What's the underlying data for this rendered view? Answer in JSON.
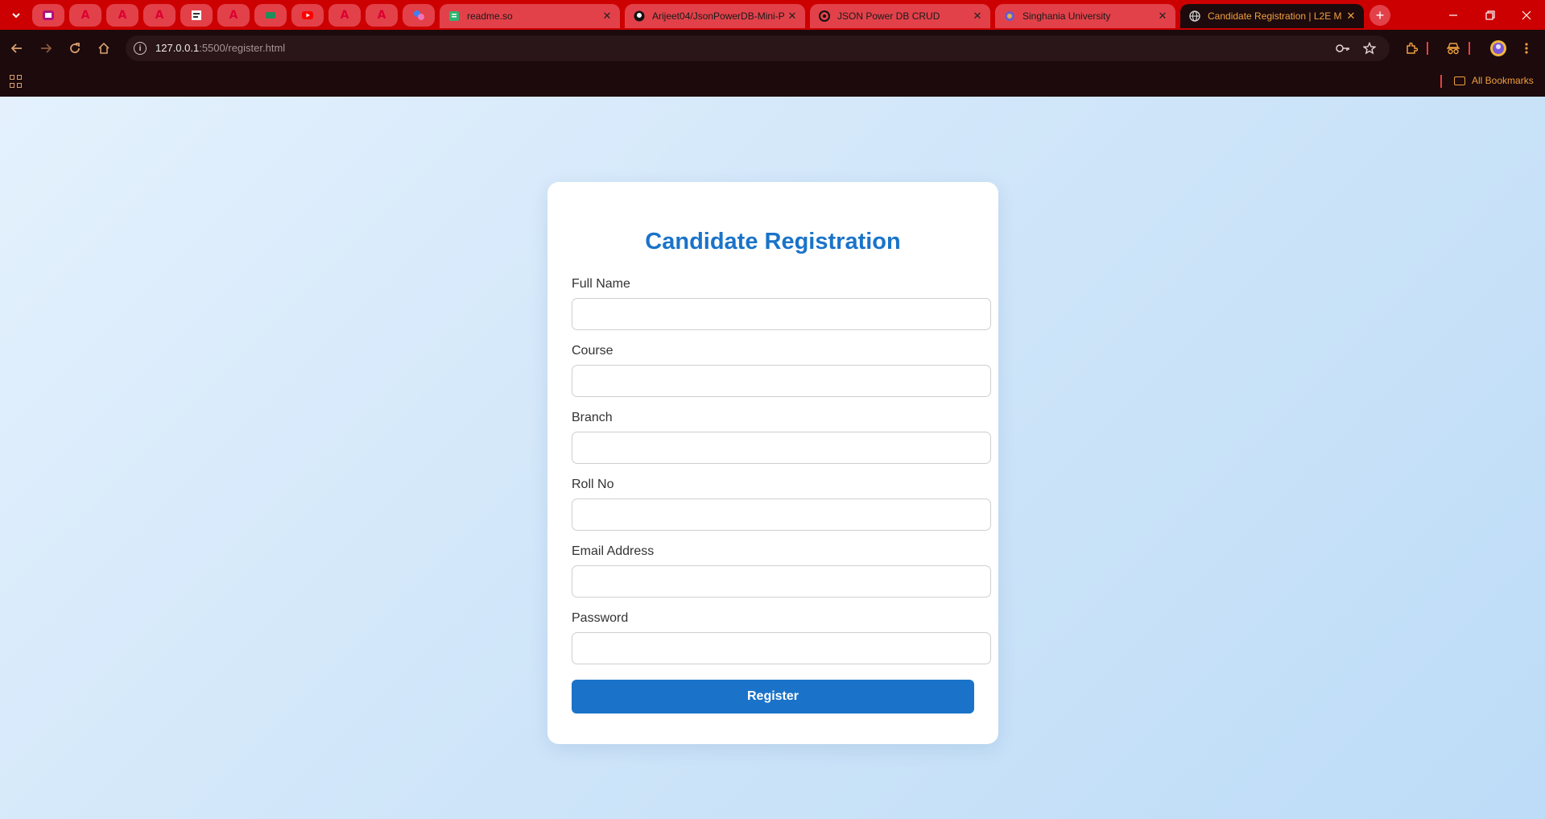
{
  "browser": {
    "pinned_tabs": [
      {
        "icon": "purple-app-icon"
      },
      {
        "icon": "angular-icon"
      },
      {
        "icon": "angular-icon"
      },
      {
        "icon": "angular-icon"
      },
      {
        "icon": "document-icon"
      },
      {
        "icon": "angular-icon"
      },
      {
        "icon": "green-app-icon"
      },
      {
        "icon": "youtube-icon"
      },
      {
        "icon": "angular-icon"
      },
      {
        "icon": "angular-icon"
      },
      {
        "icon": "puzzle-app-icon"
      }
    ],
    "tabs": [
      {
        "title": "readme.so",
        "icon": "readme-icon"
      },
      {
        "title": "Arijeet04/JsonPowerDB-Mini-P",
        "icon": "github-icon"
      },
      {
        "title": "JSON Power DB CRUD",
        "icon": "openai-icon"
      },
      {
        "title": "Singhania University",
        "icon": "university-icon"
      },
      {
        "title": "Candidate Registration | L2E M",
        "icon": "globe-icon",
        "active": true
      }
    ],
    "new_tab": "+",
    "url_host": "127.0.0.1",
    "url_rest": ":5500/register.html",
    "bookmarks_label": "All Bookmarks",
    "colors": {
      "tabstrip": "#cc0000",
      "accent": "#f0a040",
      "frame": "#1c0a0c"
    }
  },
  "form": {
    "title": "Candidate Registration",
    "fields": [
      {
        "label": "Full Name",
        "value": ""
      },
      {
        "label": "Course",
        "value": ""
      },
      {
        "label": "Branch",
        "value": ""
      },
      {
        "label": "Roll No",
        "value": ""
      },
      {
        "label": "Email Address",
        "value": ""
      },
      {
        "label": "Password",
        "value": ""
      }
    ],
    "submit_label": "Register",
    "colors": {
      "primary": "#1a73c9"
    }
  }
}
